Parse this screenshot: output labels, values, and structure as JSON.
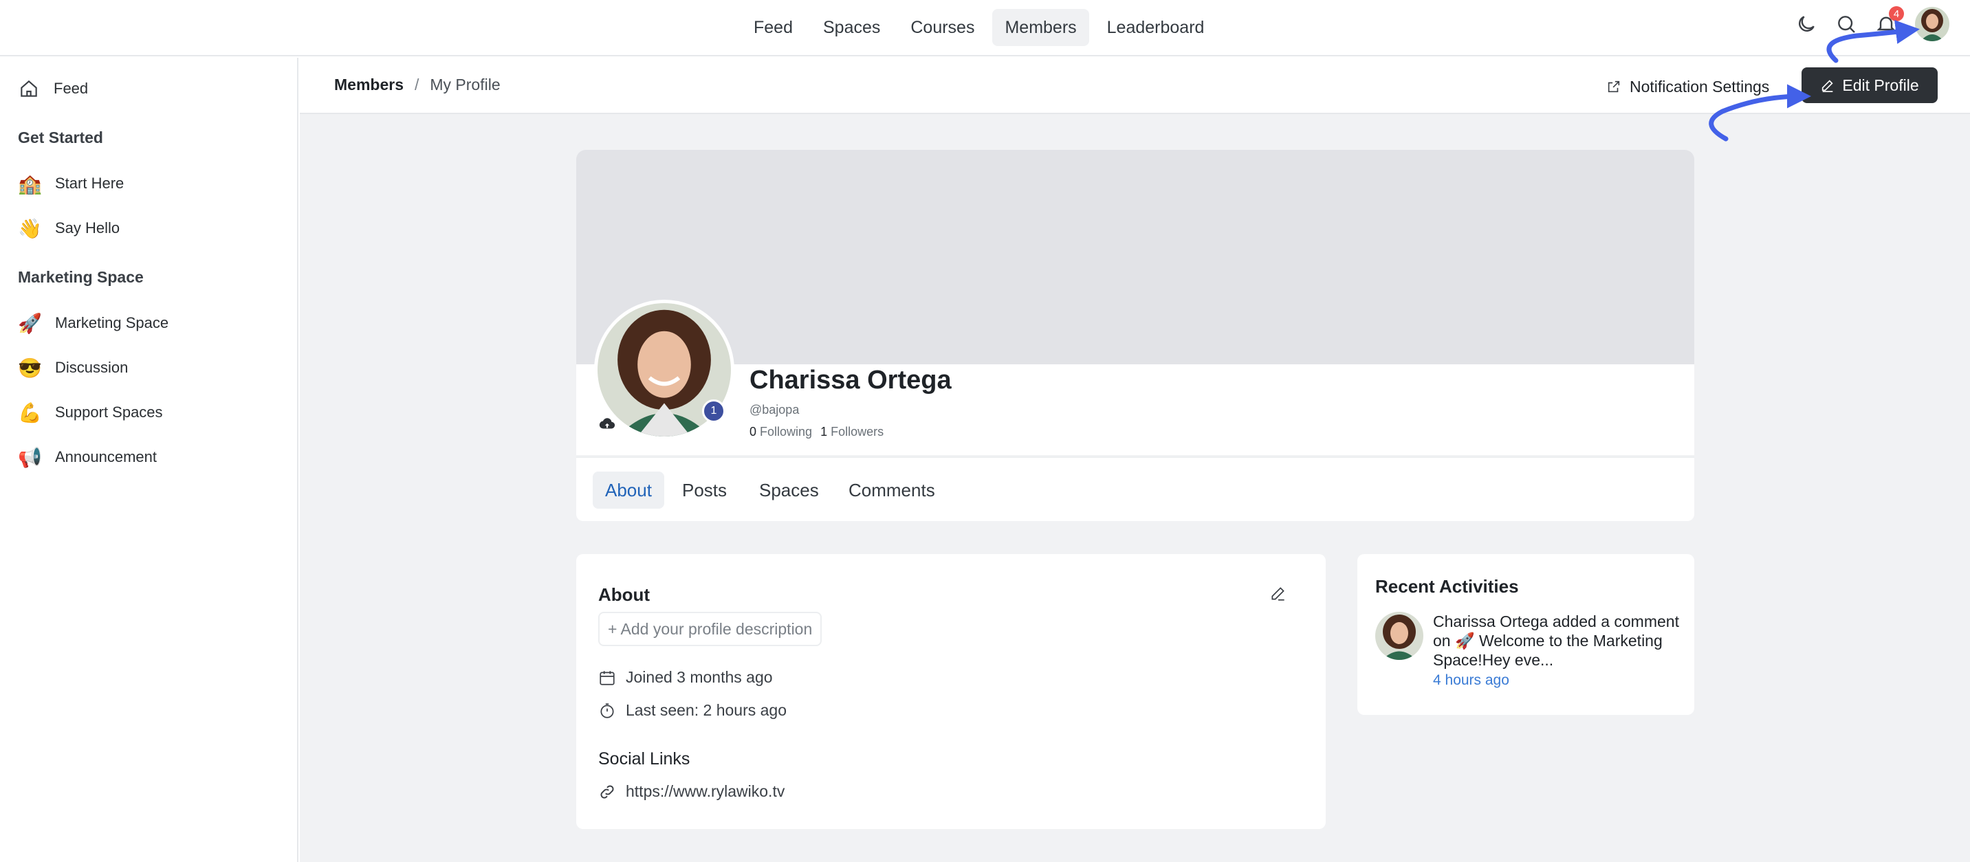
{
  "topnav": {
    "items": [
      {
        "label": "Feed",
        "active": false
      },
      {
        "label": "Spaces",
        "active": false
      },
      {
        "label": "Courses",
        "active": false
      },
      {
        "label": "Members",
        "active": true
      },
      {
        "label": "Leaderboard",
        "active": false
      }
    ],
    "notification_count": "4",
    "icons": [
      "moon-icon",
      "search-icon",
      "bell-icon"
    ]
  },
  "sidebar": {
    "feed_label": "Feed",
    "groups": [
      {
        "heading": "Get Started",
        "items": [
          {
            "emoji": "🏫",
            "label": "Start Here"
          },
          {
            "emoji": "👋",
            "label": "Say Hello"
          }
        ]
      },
      {
        "heading": "Marketing Space",
        "items": [
          {
            "emoji": "🚀",
            "label": "Marketing Space"
          },
          {
            "emoji": "😎",
            "label": "Discussion"
          },
          {
            "emoji": "💪",
            "label": "Support Spaces"
          },
          {
            "emoji": "📢",
            "label": "Announcement"
          }
        ]
      }
    ]
  },
  "breadcrumb": {
    "root": "Members",
    "separator": "/",
    "current": "My Profile"
  },
  "actions": {
    "notification_settings": "Notification Settings",
    "edit_profile": "Edit Profile"
  },
  "profile": {
    "name": "Charissa Ortega",
    "handle": "@bajopa",
    "following_count": "0",
    "following_label": "Following",
    "followers_count": "1",
    "followers_label": "Followers",
    "avatar_badge": "1"
  },
  "tabs": [
    {
      "label": "About",
      "active": true
    },
    {
      "label": "Posts",
      "active": false
    },
    {
      "label": "Spaces",
      "active": false
    },
    {
      "label": "Comments",
      "active": false
    }
  ],
  "about": {
    "title": "About",
    "add_description": "+ Add your profile description",
    "joined": "Joined 3 months ago",
    "last_seen": "Last seen: 2 hours ago",
    "social_title": "Social Links",
    "social_link": "https://www.rylawiko.tv"
  },
  "recent": {
    "title": "Recent Activities",
    "actor": "Charissa Ortega",
    "action": " added a comment on ",
    "target": "🚀 Welcome to the Marketing Space!Hey eve...",
    "time": "4 hours ago"
  },
  "colors": {
    "accent": "#2163b8",
    "dark_button": "#2d3136",
    "annotation_arrow": "#4361e8",
    "badge": "#ef5350"
  }
}
